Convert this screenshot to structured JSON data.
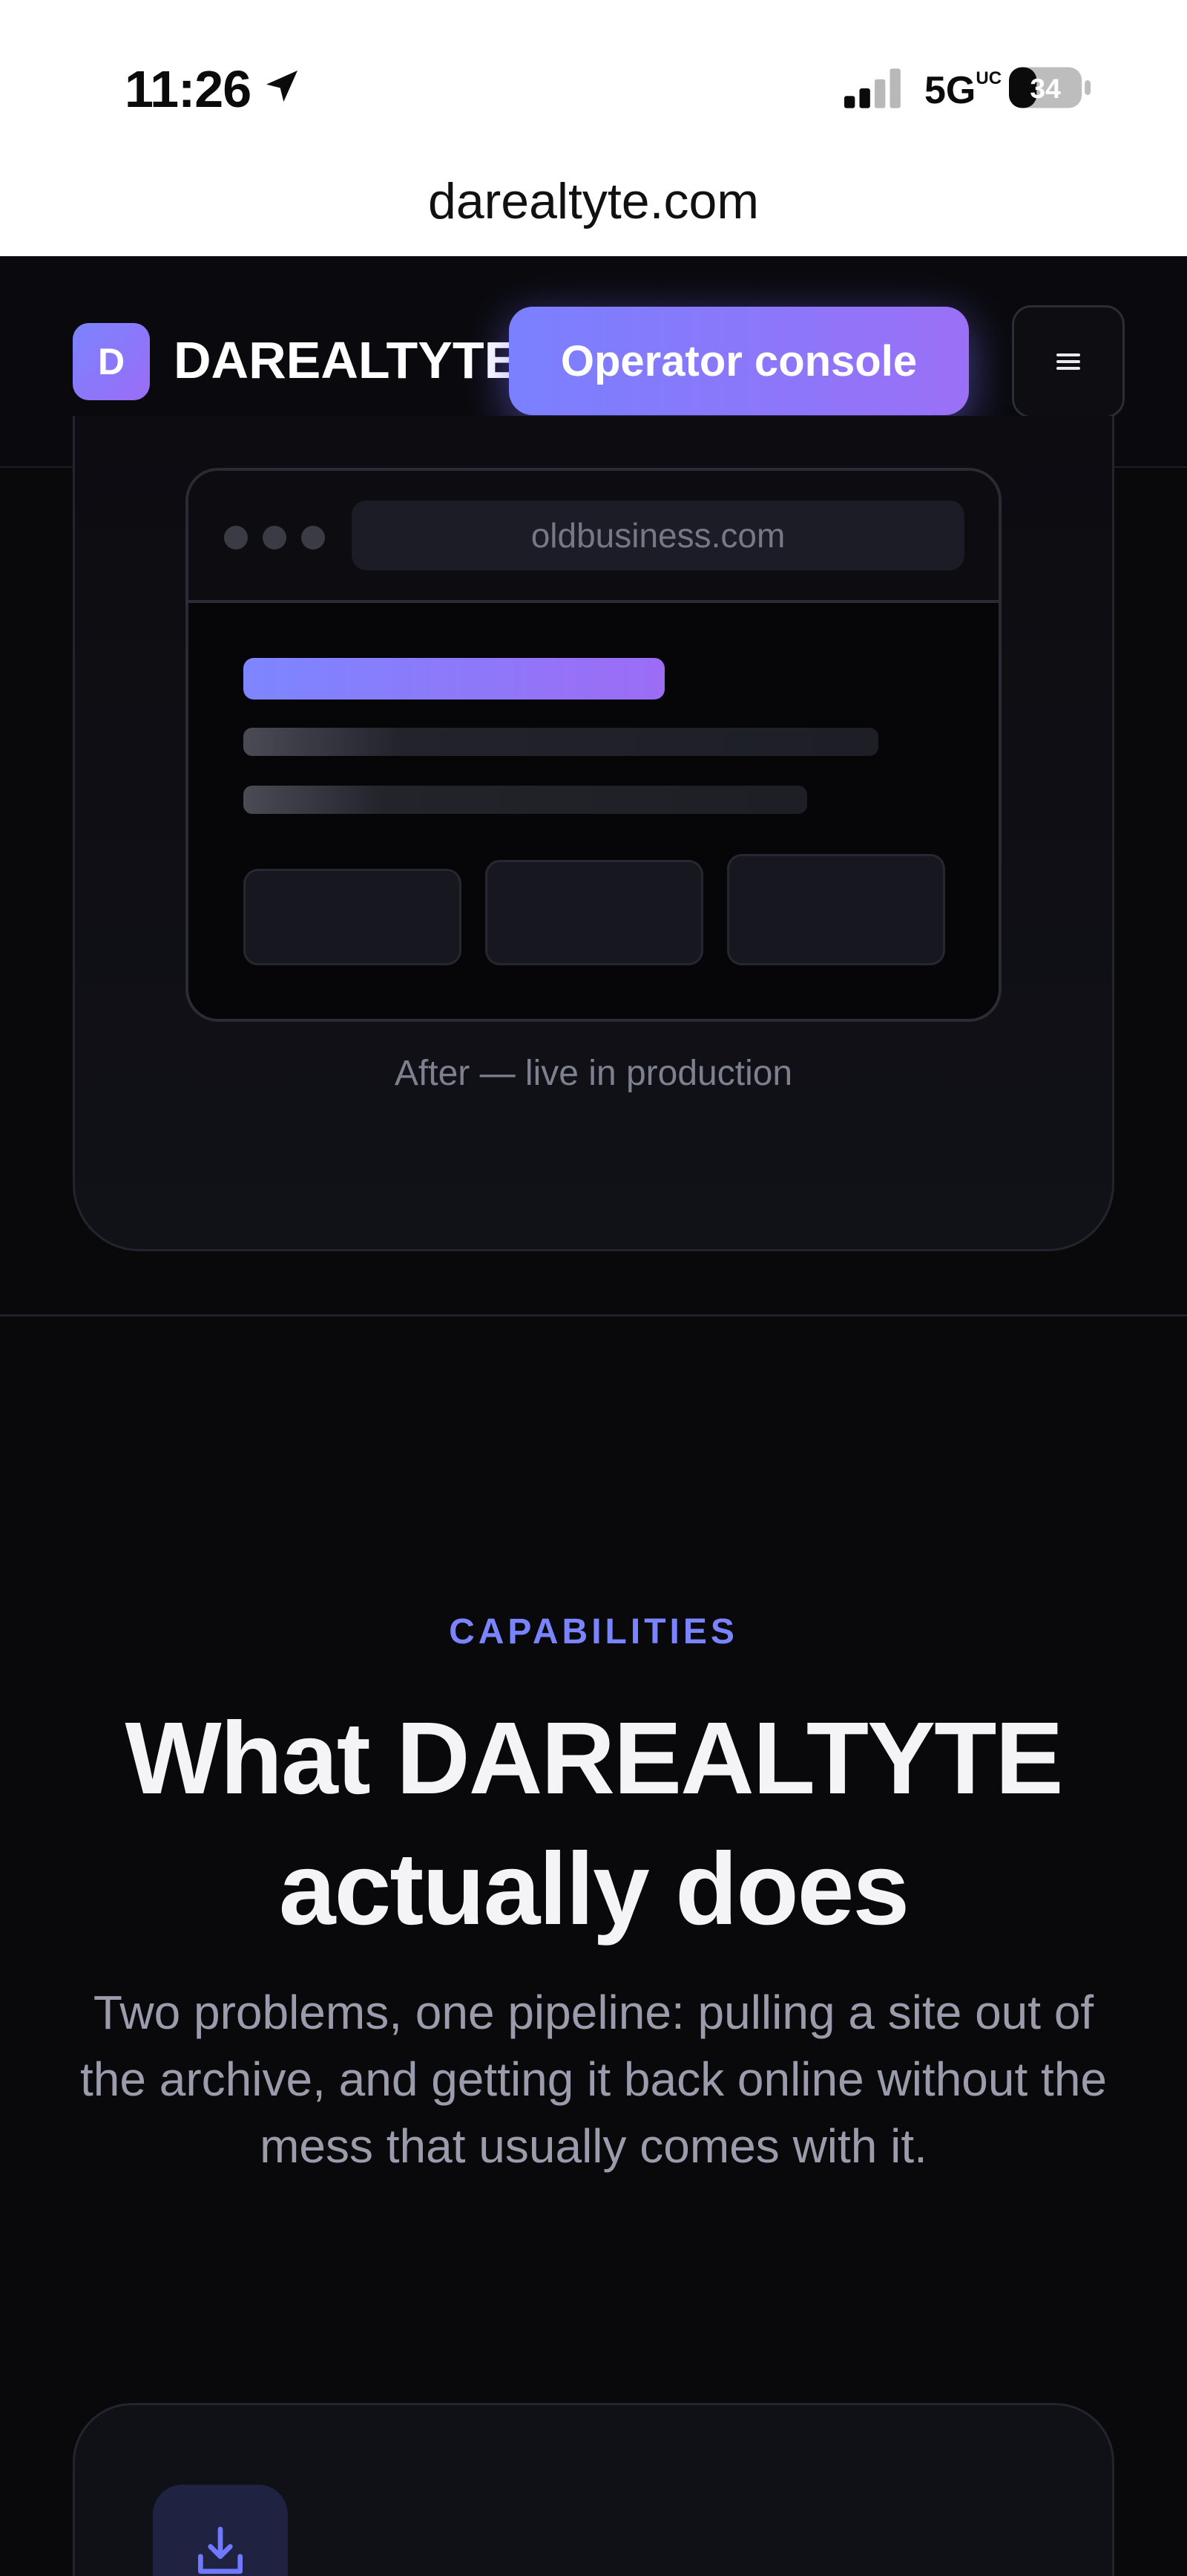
{
  "status_bar": {
    "time": "11:26",
    "network": "5G",
    "network_suffix": "UC",
    "battery": "34"
  },
  "browser_url": "darealtyte.com",
  "header": {
    "logo_letter": "D",
    "brand": "DAREALTYTE",
    "console_button": "Operator console",
    "menu_icon": "≡"
  },
  "showcase": {
    "address": "oldbusiness.com",
    "caption": "After — live in production"
  },
  "capabilities": {
    "eyebrow": "CAPABILITIES",
    "headline": "What DAREALTYTE actually does",
    "subtext": "Two problems, one pipeline: pulling a site out of the archive, and getting it back online without the mess that usually comes with it."
  },
  "icons": {
    "location": "location-arrow-icon",
    "signal": "signal-bars-icon",
    "battery": "battery-icon",
    "menu": "hamburger-menu-icon",
    "download": "download-tray-icon"
  },
  "colors": {
    "accent_start": "#7b83ff",
    "accent_end": "#9a6df5",
    "background": "#09090c"
  }
}
